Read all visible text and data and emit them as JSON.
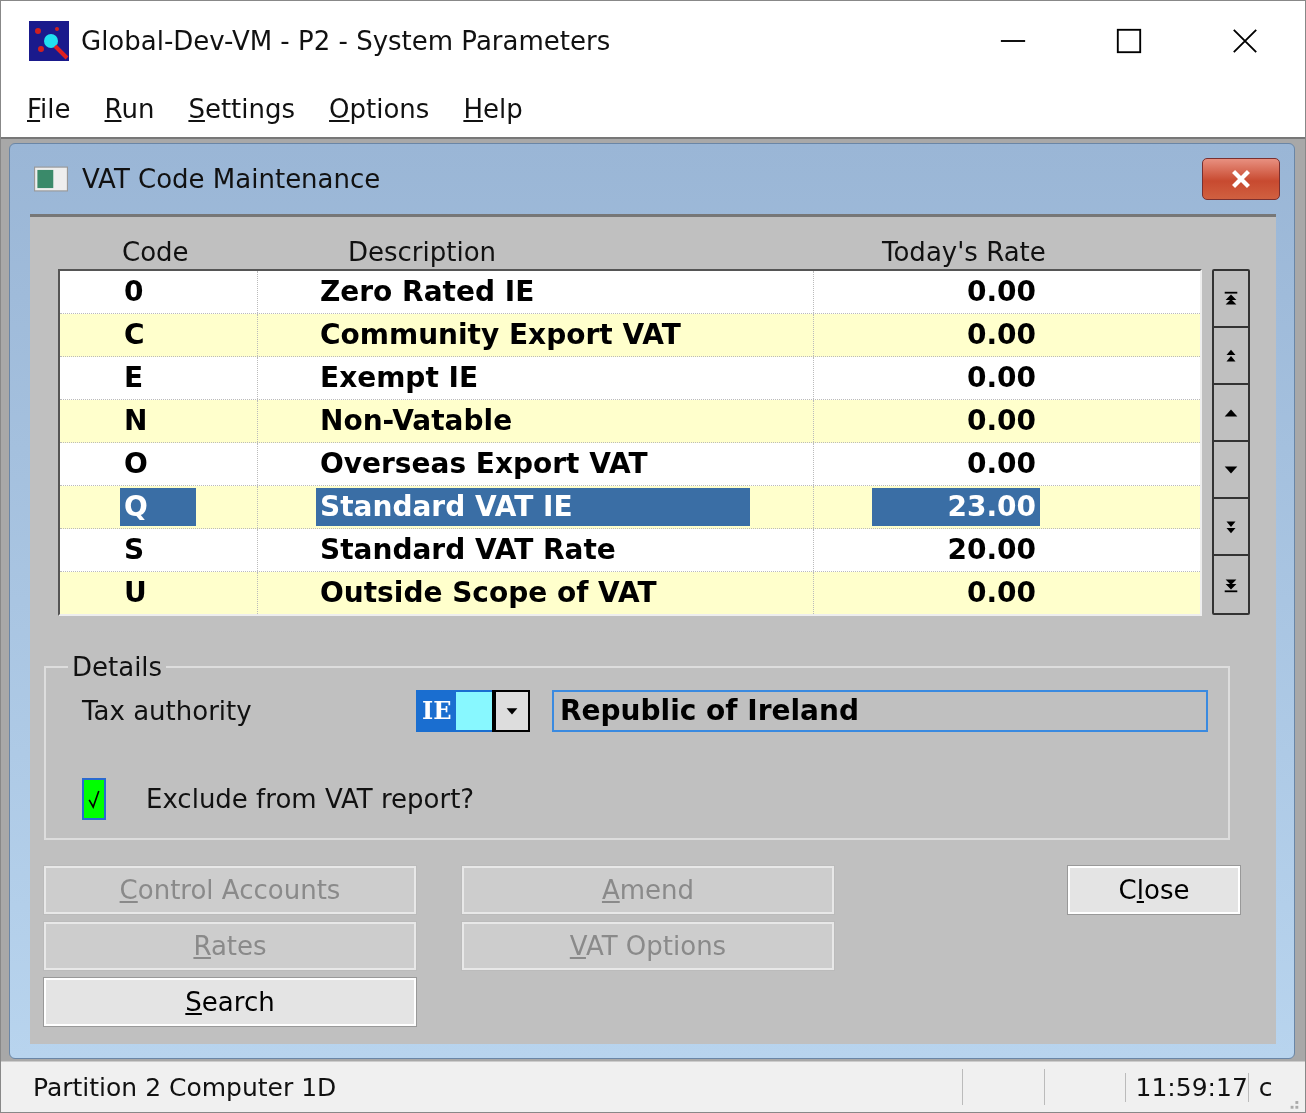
{
  "window": {
    "title": "Global-Dev-VM - P2 - System Parameters"
  },
  "menu": [
    {
      "key": "F",
      "post": "ile"
    },
    {
      "key": "R",
      "post": "un"
    },
    {
      "key": "S",
      "post": "ettings"
    },
    {
      "key": "O",
      "post": "ptions"
    },
    {
      "key": "H",
      "post": "elp"
    }
  ],
  "dialog": {
    "title": "VAT Code Maintenance"
  },
  "table": {
    "columns": [
      "Code",
      "Description",
      "Today's Rate"
    ],
    "rows": [
      {
        "code": "0",
        "description": "Zero Rated IE",
        "rate": "0.00",
        "selected": false
      },
      {
        "code": "C",
        "description": "Community Export VAT",
        "rate": "0.00",
        "selected": false
      },
      {
        "code": "E",
        "description": "Exempt IE",
        "rate": "0.00",
        "selected": false
      },
      {
        "code": "N",
        "description": "Non-Vatable",
        "rate": "0.00",
        "selected": false
      },
      {
        "code": "O",
        "description": "Overseas Export VAT",
        "rate": "0.00",
        "selected": false
      },
      {
        "code": "Q",
        "description": "Standard VAT IE",
        "rate": "23.00",
        "selected": true
      },
      {
        "code": "S",
        "description": "Standard VAT Rate",
        "rate": "20.00",
        "selected": false
      },
      {
        "code": "U",
        "description": "Outside Scope of VAT",
        "rate": "0.00",
        "selected": false
      }
    ]
  },
  "details": {
    "title": "Details",
    "tax_authority": {
      "label": "Tax authority",
      "code": "IE",
      "name": "Republic of Ireland"
    },
    "exclude": {
      "label": "Exclude from VAT report?",
      "checked": true
    }
  },
  "buttons": [
    {
      "key": "C",
      "post": "ontrol Accounts",
      "disabled": true
    },
    {
      "key": "A",
      "post": "mend",
      "disabled": true
    },
    {
      "pre": "C",
      "key": "l",
      "post": "ose",
      "disabled": false
    },
    {
      "key": "R",
      "post": "ates",
      "disabled": true
    },
    {
      "key": "V",
      "post": "AT Options",
      "disabled": true
    },
    {
      "key": "S",
      "post": "earch",
      "disabled": false
    }
  ],
  "status_bar": {
    "text": "Partition 2 Computer 1D",
    "time": "11:59:17",
    "extra": "c"
  }
}
